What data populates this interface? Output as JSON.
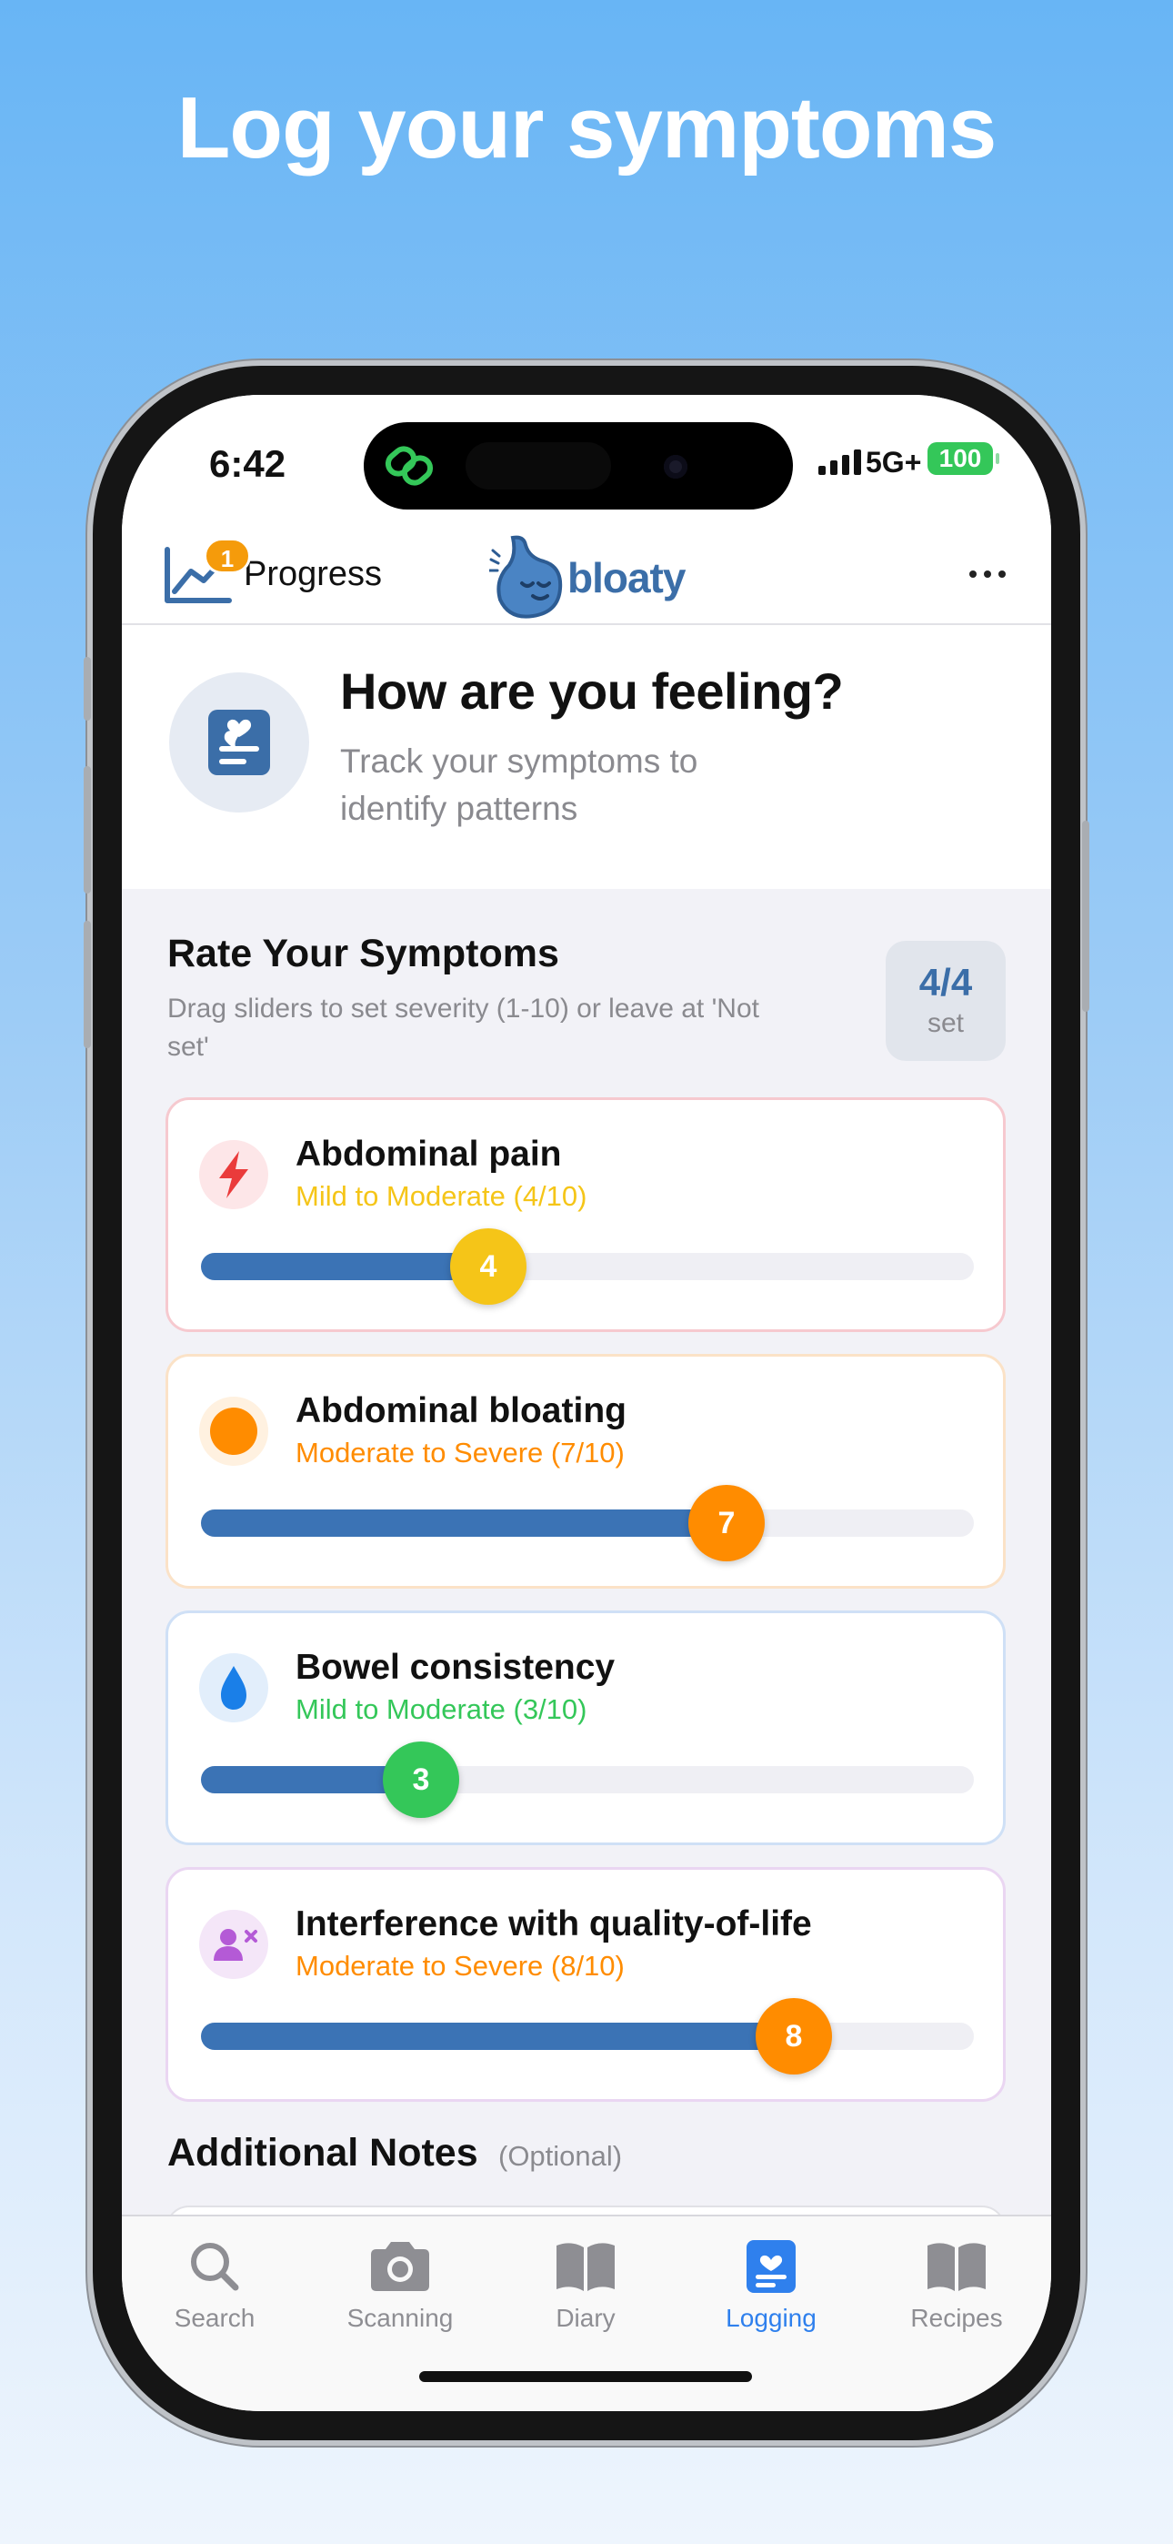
{
  "headline": "Log your symptoms",
  "status_bar": {
    "time": "6:42",
    "network": "5G+",
    "battery": "100"
  },
  "header": {
    "badge_count": "1",
    "progress_label": "Progress",
    "logo_text": "bloaty"
  },
  "feeling": {
    "title": "How are you feeling?",
    "subtitle": "Track your symptoms to identify patterns"
  },
  "rate": {
    "title": "Rate Your Symptoms",
    "subtitle": "Drag sliders to set severity (1-10) or leave at 'Not set'",
    "set_count": "4/4",
    "set_label": "set"
  },
  "symptoms": [
    {
      "name": "Abdominal pain",
      "severity_label": "Mild to Moderate (4/10)",
      "value": 4,
      "max": 10,
      "icon": "lightning-icon",
      "color": "#f5c518"
    },
    {
      "name": "Abdominal bloating",
      "severity_label": "Moderate to Severe (7/10)",
      "value": 7,
      "max": 10,
      "icon": "orange-circle-icon",
      "color": "#ff8c00"
    },
    {
      "name": "Bowel consistency",
      "severity_label": "Mild to Moderate (3/10)",
      "value": 3,
      "max": 10,
      "icon": "water-drop-icon",
      "color": "#34c759"
    },
    {
      "name": "Interference with quality-of-life",
      "severity_label": "Moderate to Severe (8/10)",
      "value": 8,
      "max": 10,
      "icon": "person-x-icon",
      "color": "#ff8c00"
    }
  ],
  "notes": {
    "title": "Additional Notes",
    "optional": "(Optional)"
  },
  "tabs": [
    {
      "label": "Search",
      "icon": "search-icon",
      "active": false
    },
    {
      "label": "Scanning",
      "icon": "camera-icon",
      "active": false
    },
    {
      "label": "Diary",
      "icon": "book-icon",
      "active": false
    },
    {
      "label": "Logging",
      "icon": "log-icon",
      "active": true
    },
    {
      "label": "Recipes",
      "icon": "book-icon",
      "active": false
    }
  ],
  "colors": {
    "accent": "#3b73b5",
    "brand": "#3b6ea8",
    "active_tab": "#2f80ed"
  }
}
